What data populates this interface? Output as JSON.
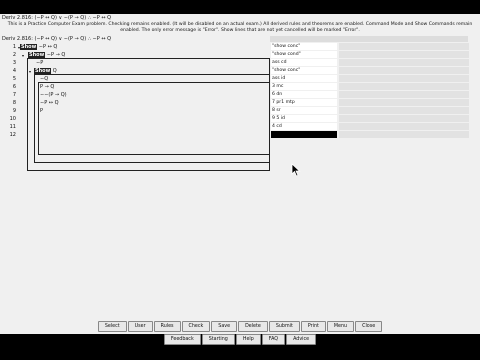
{
  "window": {
    "title": "Deriv 2.816:  (∼P ↔ Q) ∨ ∼(P → Q)  ∴  ∼P ↔ Q",
    "info_line1": "This is a Practice Computer Exam problem.  Checking remains enabled.  (It will be disabled on an actual exam.)  All derived rules and theorems are enabled.  Command Mode and Show Commands remain",
    "info_line2": "enabled.  The only error message is \"Error\".  Show lines that are not yet cancelled will be marked \"Error\".",
    "subheader": "Deriv 2.816:  (∼P ↔ Q) ∨ ∼(P → Q)  ∴  ∼P ↔ Q"
  },
  "lines": [
    {
      "num": "1",
      "expand": "▾",
      "tag": "Show",
      "text": " ∼P ↔ Q",
      "just": "\"show conc\""
    },
    {
      "num": "2",
      "expand": "▾",
      "tag": "Show",
      "text": " ∼P → Q",
      "just": "\"show cond\""
    },
    {
      "num": "3",
      "expand": "",
      "tag": "",
      "text": "∼P",
      "just": "ass cd"
    },
    {
      "num": "4",
      "expand": "▾",
      "tag": "Show",
      "text": " Q",
      "just": "\"show conc\""
    },
    {
      "num": "5",
      "expand": "",
      "tag": "",
      "text": "∼Q",
      "just": "ass id"
    },
    {
      "num": "6",
      "expand": "",
      "tag": "",
      "text": "P → Q",
      "just": "3 mc"
    },
    {
      "num": "7",
      "expand": "",
      "tag": "",
      "text": "∼∼(P → Q)",
      "just": "6 dn"
    },
    {
      "num": "8",
      "expand": "",
      "tag": "",
      "text": "∼P ↔ Q",
      "just": "7 pr1 mtp"
    },
    {
      "num": "9",
      "expand": "",
      "tag": "",
      "text": "P",
      "just": "8 sr"
    },
    {
      "num": "10",
      "expand": "",
      "tag": "",
      "text": "",
      "just": "9 5 id"
    },
    {
      "num": "11",
      "expand": "",
      "tag": "",
      "text": "",
      "just": "4 cd"
    },
    {
      "num": "12",
      "expand": "",
      "tag": "",
      "text": "",
      "just": ""
    }
  ],
  "buttons_row1": [
    "Select",
    "User",
    "Rules",
    "Check",
    "Save",
    "Delete",
    "Submit",
    "Print",
    "Menu",
    "Close"
  ],
  "buttons_row2": [
    "Feedback",
    "Starting",
    "Help",
    "FAQ",
    "Advice"
  ]
}
